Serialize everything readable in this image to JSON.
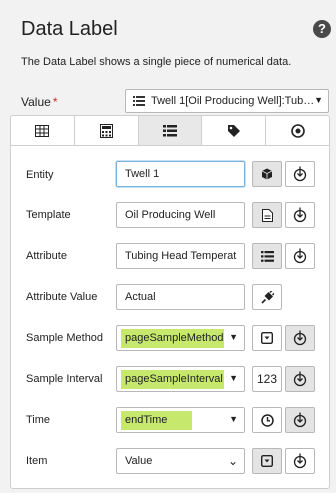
{
  "header": {
    "title": "Data Label",
    "help": "?",
    "description": "The Data Label shows a single piece of numerical data."
  },
  "value": {
    "label": "Value",
    "required_mark": "*",
    "selected": "Twell 1[Oil Producing Well]:Tub…"
  },
  "tabs": [
    "table-icon",
    "calculator-icon",
    "list-icon",
    "tag-icon",
    "target-icon"
  ],
  "rows": {
    "entity": {
      "label": "Entity",
      "value": "Twell 1"
    },
    "template": {
      "label": "Template",
      "value": "Oil Producing Well"
    },
    "attribute": {
      "label": "Attribute",
      "value": "Tubing Head Temperat"
    },
    "attribute_value": {
      "label": "Attribute Value",
      "value": "Actual"
    },
    "sample_method": {
      "label": "Sample Method",
      "value": "pageSampleMethod"
    },
    "sample_interval": {
      "label": "Sample Interval",
      "value": "pageSampleInterval",
      "button": "123"
    },
    "time": {
      "label": "Time",
      "value": "endTime"
    },
    "item": {
      "label": "Item",
      "value": "Value"
    }
  },
  "colors": {
    "highlight": "#c6e86d",
    "help_bg": "#4a4a4a",
    "required": "#dd2222"
  }
}
